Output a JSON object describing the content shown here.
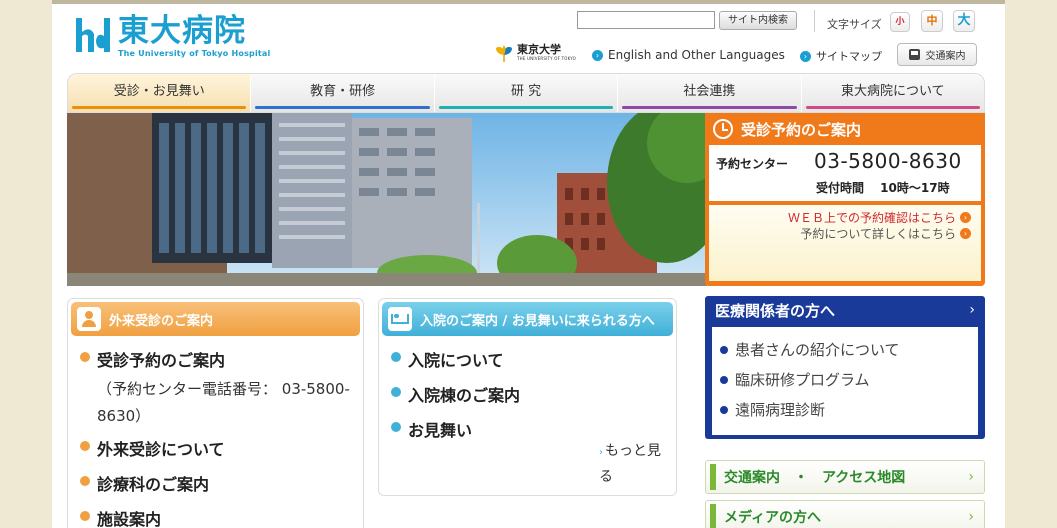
{
  "header": {
    "logo_jp": "東大病院",
    "logo_en": "The University of Tokyo Hospital",
    "search_placeholder": "",
    "search_button": "サイト内検索",
    "font_size_label": "文字サイズ",
    "font_sizes": [
      "小",
      "中",
      "大"
    ],
    "utokyo_jp": "東京大学",
    "utokyo_en": "THE UNIVERSITY OF TOKYO",
    "link_languages": "English and Other Languages",
    "link_sitemap": "サイトマップ",
    "access_button": "交通案内"
  },
  "nav": {
    "items": [
      "受診・お見舞い",
      "教育・研修",
      "研 究",
      "社会連携",
      "東大病院について"
    ]
  },
  "reservation": {
    "title": "受診予約のご案内",
    "center_label": "予約センター",
    "phone": "03-5800-8630",
    "hours": "受付時間　 10時～17時",
    "link_web": "ＷＥＢ上での予約確認はこちら",
    "link_details": "予約について詳しくはこちら"
  },
  "outpatient": {
    "title": "外来受診のご案内",
    "item1": "受診予約のご案内",
    "item1_sub": "（予約センター電話番号： 03-5800-8630）",
    "item2": "外来受診について",
    "item3": "診療科のご案内",
    "item4": "施設案内"
  },
  "inpatient": {
    "title": "入院のご案内 / お見舞いに来られる方へ",
    "items": [
      "入院について",
      "入院棟のご案内",
      "お見舞い"
    ],
    "more": "もっと見る"
  },
  "professionals": {
    "title": "医療関係者の方へ",
    "items": [
      "患者さんの紹介について",
      "臨床研修プログラム",
      "遠隔病理診断"
    ]
  },
  "access_map": "交通案内　・　アクセス地図",
  "media": "メディアの方へ",
  "colors": {
    "brand_blue": "#1a9fd0",
    "orange": "#f07a1a",
    "navy": "#1a3a9a",
    "green": "#7ab83a"
  }
}
